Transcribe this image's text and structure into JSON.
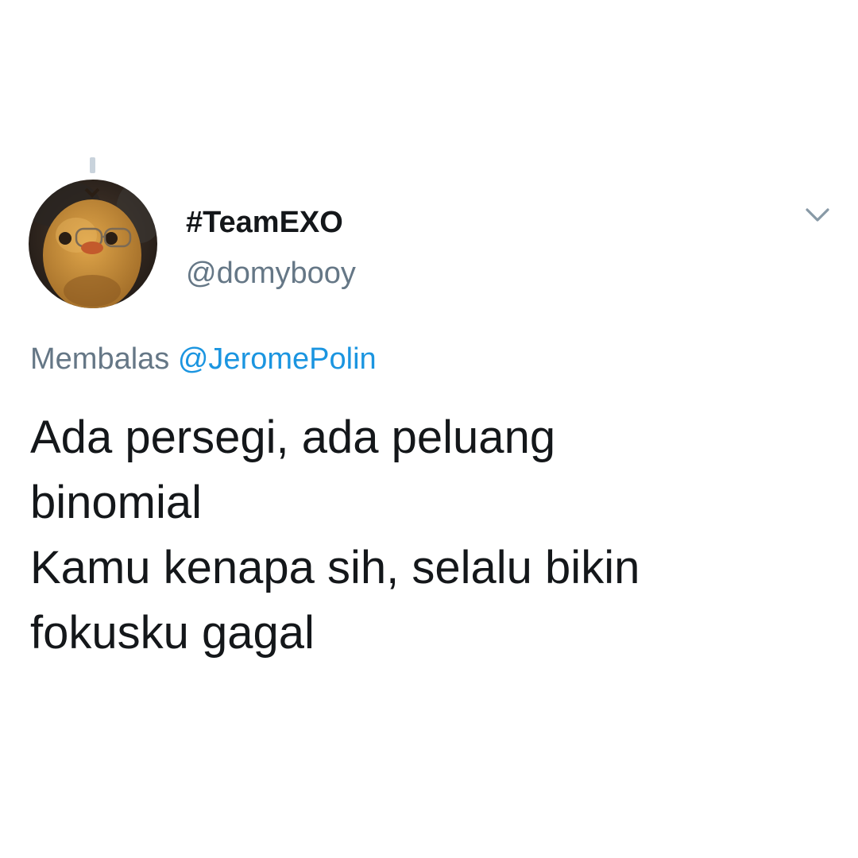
{
  "author": {
    "display_name": "#TeamEXO",
    "handle": "@domybooy",
    "avatar_icon": "plush-chick-avatar"
  },
  "reply": {
    "prefix": "Membalas",
    "mention": "@JeromePolin"
  },
  "tweet": {
    "lines": [
      "Ada persegi, ada peluang",
      "binomial",
      "Kamu kenapa sih, selalu bikin",
      "fokusku gagal"
    ]
  },
  "icons": {
    "menu": "chevron-down-icon"
  },
  "colors": {
    "text_primary": "#14171a",
    "text_secondary": "#657786",
    "link": "#1b95e0",
    "background": "#ffffff"
  }
}
